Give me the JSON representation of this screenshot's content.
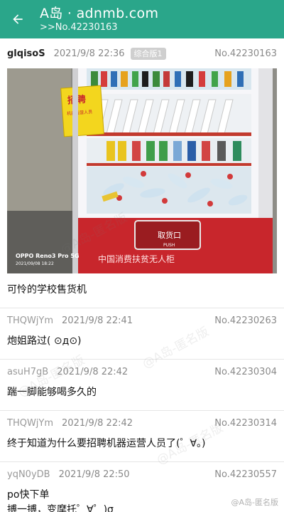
{
  "appbar": {
    "title": "A岛 · adnmb.com",
    "subtitle": ">>No.42230163"
  },
  "thread": {
    "uid": "glqisoS",
    "time": "2021/9/8 22:36",
    "board": "综合版1",
    "no": "No.42230163",
    "content": "可怜的学校售货机",
    "photo": {
      "sign_main": "招聘",
      "sign_sub": "机器运营人员",
      "pickup_label": "取货口",
      "pickup_sub": "PUSH",
      "banner_text": "中国消费扶贫无人柜",
      "camera": "OPPO Reno3 Pro 5G",
      "date": "2021/09/08 18:22"
    }
  },
  "replies": [
    {
      "uid": "THQWjYm",
      "time": "2021/9/8 22:41",
      "no": "No.42230263",
      "content": "炮姐路过( ⊙д⊙)"
    },
    {
      "uid": "asuH7gB",
      "time": "2021/9/8 22:42",
      "no": "No.42230304",
      "content": "踹一脚能够喝多久的"
    },
    {
      "uid": "THQWjYm",
      "time": "2021/9/8 22:42",
      "no": "No.42230314",
      "content": "终于知道为什么要招聘机器运营人员了(゜∀。)"
    },
    {
      "uid": "yqN0yDB",
      "time": "2021/9/8 22:50",
      "no": "No.42230557",
      "content": "po快下单\n搏一搏，变摩托゜∀゜)σ"
    }
  ],
  "watermarks": {
    "anon": "@A岛-匿名版",
    "weibo": "@A岛-匿名版"
  },
  "colors": {
    "appbar": "#2aa68a",
    "machine_red": "#c8262c"
  }
}
